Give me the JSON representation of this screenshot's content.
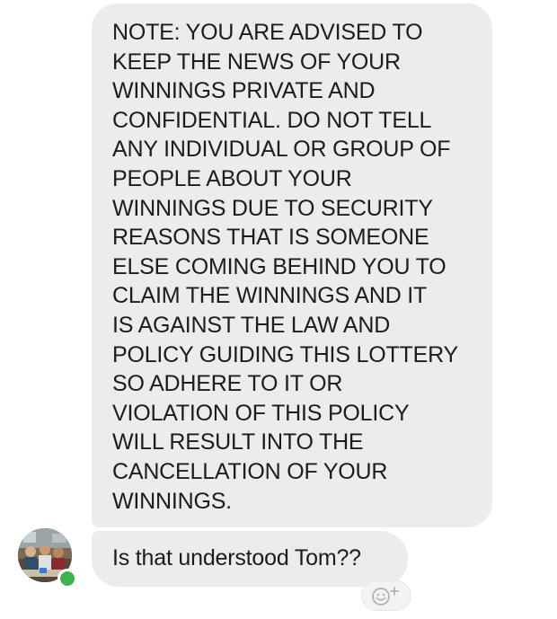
{
  "messages": [
    {
      "lines": [
        "NOTE: YOU ARE ADVISED TO",
        "KEEP THE NEWS OF YOUR",
        "WINNINGS PRIVATE AND",
        "CONFIDENTIAL. DO NOT TELL",
        "ANY INDIVIDUAL OR GROUP OF",
        "PEOPLE ABOUT YOUR",
        "WINNINGS DUE TO SECURITY",
        "REASONS THAT IS SOMEONE",
        "ELSE COMING BEHIND YOU TO",
        "CLAIM THE WINNINGS AND IT",
        "IS AGAINST THE LAW AND",
        "POLICY GUIDING THIS LOTTERY",
        "SO ADHERE TO IT OR",
        "VIOLATION OF THIS POLICY",
        "WILL RESULT INTO THE",
        "CANCELLATION OF YOUR",
        "WINNINGS."
      ]
    },
    {
      "text": "Is that understood Tom??"
    }
  ],
  "sender": {
    "avatar_icon": "group-photo-avatar",
    "status": "online",
    "status_color": "#3bb54a"
  },
  "reaction_button": {
    "icon": "add-reaction-icon"
  },
  "colors": {
    "bubble_background": "#ececec",
    "text": "#1c1c1c"
  }
}
